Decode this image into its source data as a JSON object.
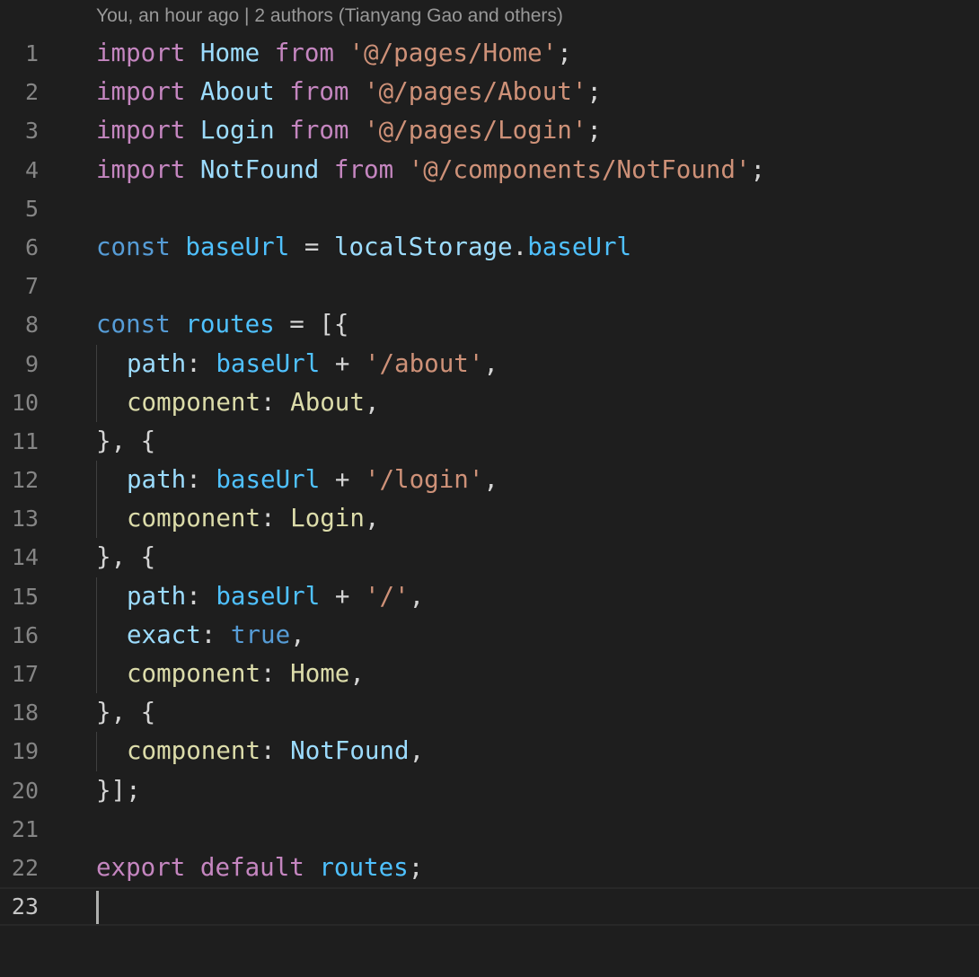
{
  "editor": {
    "codelens": "You, an hour ago | 2 authors (Tianyang Gao and others)",
    "lines": [
      {
        "n": "1",
        "tokens": [
          [
            "kw",
            "import"
          ],
          [
            "pun",
            " "
          ],
          [
            "var",
            "Home"
          ],
          [
            "pun",
            " "
          ],
          [
            "kw",
            "from"
          ],
          [
            "pun",
            " "
          ],
          [
            "str",
            "'@/pages/Home'"
          ],
          [
            "pun",
            ";"
          ]
        ]
      },
      {
        "n": "2",
        "tokens": [
          [
            "kw",
            "import"
          ],
          [
            "pun",
            " "
          ],
          [
            "var",
            "About"
          ],
          [
            "pun",
            " "
          ],
          [
            "kw",
            "from"
          ],
          [
            "pun",
            " "
          ],
          [
            "str",
            "'@/pages/About'"
          ],
          [
            "pun",
            ";"
          ]
        ]
      },
      {
        "n": "3",
        "tokens": [
          [
            "kw",
            "import"
          ],
          [
            "pun",
            " "
          ],
          [
            "var",
            "Login"
          ],
          [
            "pun",
            " "
          ],
          [
            "kw",
            "from"
          ],
          [
            "pun",
            " "
          ],
          [
            "str",
            "'@/pages/Login'"
          ],
          [
            "pun",
            ";"
          ]
        ]
      },
      {
        "n": "4",
        "tokens": [
          [
            "kw",
            "import"
          ],
          [
            "pun",
            " "
          ],
          [
            "var",
            "NotFound"
          ],
          [
            "pun",
            " "
          ],
          [
            "kw",
            "from"
          ],
          [
            "pun",
            " "
          ],
          [
            "str",
            "'@/components/NotFound'"
          ],
          [
            "pun",
            ";"
          ]
        ]
      },
      {
        "n": "5",
        "tokens": []
      },
      {
        "n": "6",
        "tokens": [
          [
            "st",
            "const"
          ],
          [
            "pun",
            " "
          ],
          [
            "cvar",
            "baseUrl"
          ],
          [
            "pun",
            " = "
          ],
          [
            "var",
            "localStorage"
          ],
          [
            "pun",
            "."
          ],
          [
            "cvar",
            "baseUrl"
          ]
        ]
      },
      {
        "n": "7",
        "tokens": []
      },
      {
        "n": "8",
        "tokens": [
          [
            "st",
            "const"
          ],
          [
            "pun",
            " "
          ],
          [
            "cvar",
            "routes"
          ],
          [
            "pun",
            " = [{"
          ]
        ]
      },
      {
        "n": "9",
        "indent": true,
        "tokens": [
          [
            "var",
            "path"
          ],
          [
            "pun",
            ": "
          ],
          [
            "cvar",
            "baseUrl"
          ],
          [
            "pun",
            " + "
          ],
          [
            "str",
            "'/about'"
          ],
          [
            "pun",
            ","
          ]
        ]
      },
      {
        "n": "10",
        "indent": true,
        "tokens": [
          [
            "prop",
            "component"
          ],
          [
            "pun",
            ": "
          ],
          [
            "prop",
            "About"
          ],
          [
            "pun",
            ","
          ]
        ]
      },
      {
        "n": "11",
        "tokens": [
          [
            "pun",
            "}, {"
          ]
        ]
      },
      {
        "n": "12",
        "indent": true,
        "tokens": [
          [
            "var",
            "path"
          ],
          [
            "pun",
            ": "
          ],
          [
            "cvar",
            "baseUrl"
          ],
          [
            "pun",
            " + "
          ],
          [
            "str",
            "'/login'"
          ],
          [
            "pun",
            ","
          ]
        ]
      },
      {
        "n": "13",
        "indent": true,
        "tokens": [
          [
            "prop",
            "component"
          ],
          [
            "pun",
            ": "
          ],
          [
            "prop",
            "Login"
          ],
          [
            "pun",
            ","
          ]
        ]
      },
      {
        "n": "14",
        "tokens": [
          [
            "pun",
            "}, {"
          ]
        ]
      },
      {
        "n": "15",
        "indent": true,
        "tokens": [
          [
            "var",
            "path"
          ],
          [
            "pun",
            ": "
          ],
          [
            "cvar",
            "baseUrl"
          ],
          [
            "pun",
            " + "
          ],
          [
            "str",
            "'/'"
          ],
          [
            "pun",
            ","
          ]
        ]
      },
      {
        "n": "16",
        "indent": true,
        "tokens": [
          [
            "var",
            "exact"
          ],
          [
            "pun",
            ": "
          ],
          [
            "st",
            "true"
          ],
          [
            "pun",
            ","
          ]
        ]
      },
      {
        "n": "17",
        "indent": true,
        "tokens": [
          [
            "prop",
            "component"
          ],
          [
            "pun",
            ": "
          ],
          [
            "prop",
            "Home"
          ],
          [
            "pun",
            ","
          ]
        ]
      },
      {
        "n": "18",
        "tokens": [
          [
            "pun",
            "}, {"
          ]
        ]
      },
      {
        "n": "19",
        "indent": true,
        "tokens": [
          [
            "prop",
            "component"
          ],
          [
            "pun",
            ": "
          ],
          [
            "var",
            "NotFound"
          ],
          [
            "pun",
            ","
          ]
        ]
      },
      {
        "n": "20",
        "tokens": [
          [
            "pun",
            "}];"
          ]
        ]
      },
      {
        "n": "21",
        "tokens": []
      },
      {
        "n": "22",
        "tokens": [
          [
            "kw",
            "export"
          ],
          [
            "pun",
            " "
          ],
          [
            "kw",
            "default"
          ],
          [
            "pun",
            " "
          ],
          [
            "cvar",
            "routes"
          ],
          [
            "pun",
            ";"
          ]
        ]
      },
      {
        "n": "23",
        "active": true,
        "tokens": []
      }
    ]
  },
  "colors": {
    "background": "#1e1e1e",
    "keyword": "#c586c0",
    "storage": "#569cd6",
    "variable": "#9cdcfe",
    "constant": "#4fc1ff",
    "string": "#ce9178",
    "function": "#dcdcaa",
    "line_number": "#858585"
  }
}
